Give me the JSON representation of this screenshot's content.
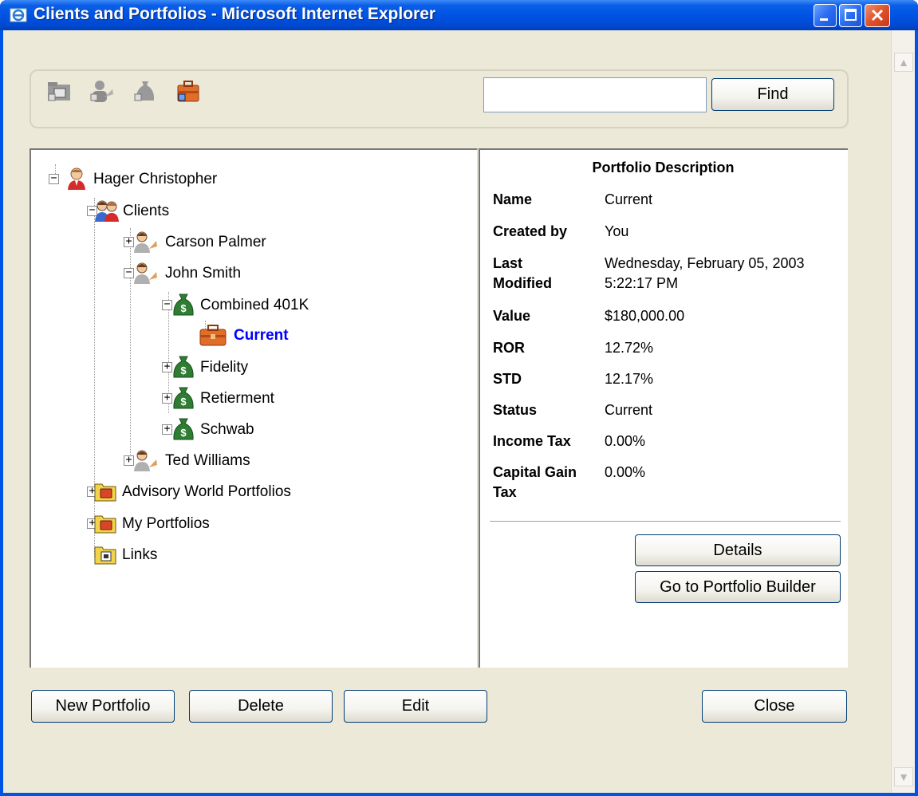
{
  "window": {
    "title": "Clients and Portfolios - Microsoft Internet Explorer"
  },
  "toolbar": {
    "icons": [
      "folder-icon",
      "person-icon",
      "moneybag-icon",
      "briefcase-icon"
    ],
    "search": {
      "value": "",
      "placeholder": ""
    },
    "find_label": "Find"
  },
  "tree": {
    "root": "Hager Christopher",
    "clients": "Clients",
    "carson": "Carson Palmer",
    "john": "John Smith",
    "combined": "Combined 401K",
    "current": "Current",
    "fidelity": "Fidelity",
    "retierment": "Retierment",
    "schwab": "Schwab",
    "ted": "Ted Williams",
    "advisory": "Advisory World Portfolios",
    "myportfolios": "My Portfolios",
    "links": "Links"
  },
  "description": {
    "title": "Portfolio Description",
    "name_key": "Name",
    "name_val": "Current",
    "created_key": "Created by",
    "created_val": "You",
    "modified_key": "Last Modified",
    "modified_val": "Wednesday, February 05, 2003 5:22:17 PM",
    "value_key": "Value",
    "value_val": "$180,000.00",
    "ror_key": "ROR",
    "ror_val": "12.72%",
    "std_key": "STD",
    "std_val": "12.17%",
    "status_key": "Status",
    "status_val": "Current",
    "income_key": "Income Tax",
    "income_val": "0.00%",
    "capgain_key": "Capital Gain Tax",
    "capgain_val": "0.00%",
    "details_label": "Details",
    "builder_label": "Go to Portfolio Builder"
  },
  "footer": {
    "new_label": "New Portfolio",
    "delete_label": "Delete",
    "edit_label": "Edit",
    "close_label": "Close"
  }
}
